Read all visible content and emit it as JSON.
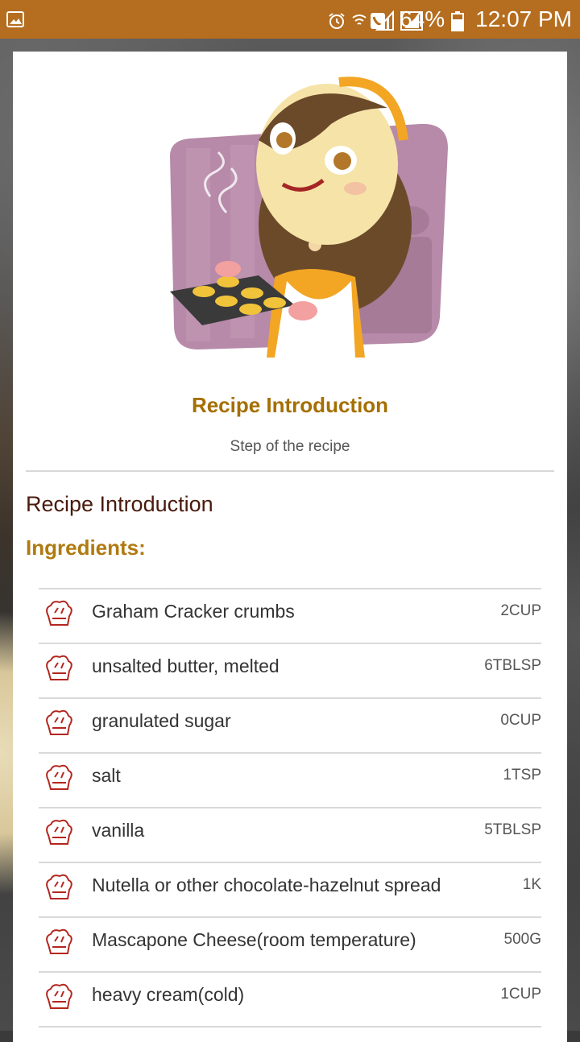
{
  "status_bar": {
    "battery": "64%",
    "time": "12:07 PM"
  },
  "recipe": {
    "hero_title": "Recipe Introduction",
    "hero_subtitle": "Step of the recipe",
    "section_title": "Recipe Introduction",
    "ingredients_label": "Ingredients:"
  },
  "ingredients": [
    {
      "name": "Graham Cracker crumbs",
      "qty": "2CUP"
    },
    {
      "name": "unsalted butter, melted",
      "qty": "6TBLSP"
    },
    {
      "name": "granulated sugar",
      "qty": "0CUP"
    },
    {
      "name": "salt",
      "qty": "1TSP"
    },
    {
      "name": "vanilla",
      "qty": "5TBLSP"
    },
    {
      "name": "Nutella or other chocolate-hazelnut spread",
      "qty": "1K"
    },
    {
      "name": "Mascapone Cheese(room temperature)",
      "qty": "500G"
    },
    {
      "name": "heavy cream(cold)",
      "qty": "1CUP"
    }
  ],
  "colors": {
    "status_bar": "#b56d1f",
    "title_gold": "#a56f00",
    "section_brown": "#4a1a0c",
    "chef_icon_red": "#b3261e"
  },
  "icons": {
    "gallery": "image-icon",
    "alarm": "alarm-icon",
    "wifi_call": "wifi-calling-icon",
    "signal": "signal-icon",
    "battery": "battery-icon",
    "ingredient": "chef-hat-icon"
  }
}
